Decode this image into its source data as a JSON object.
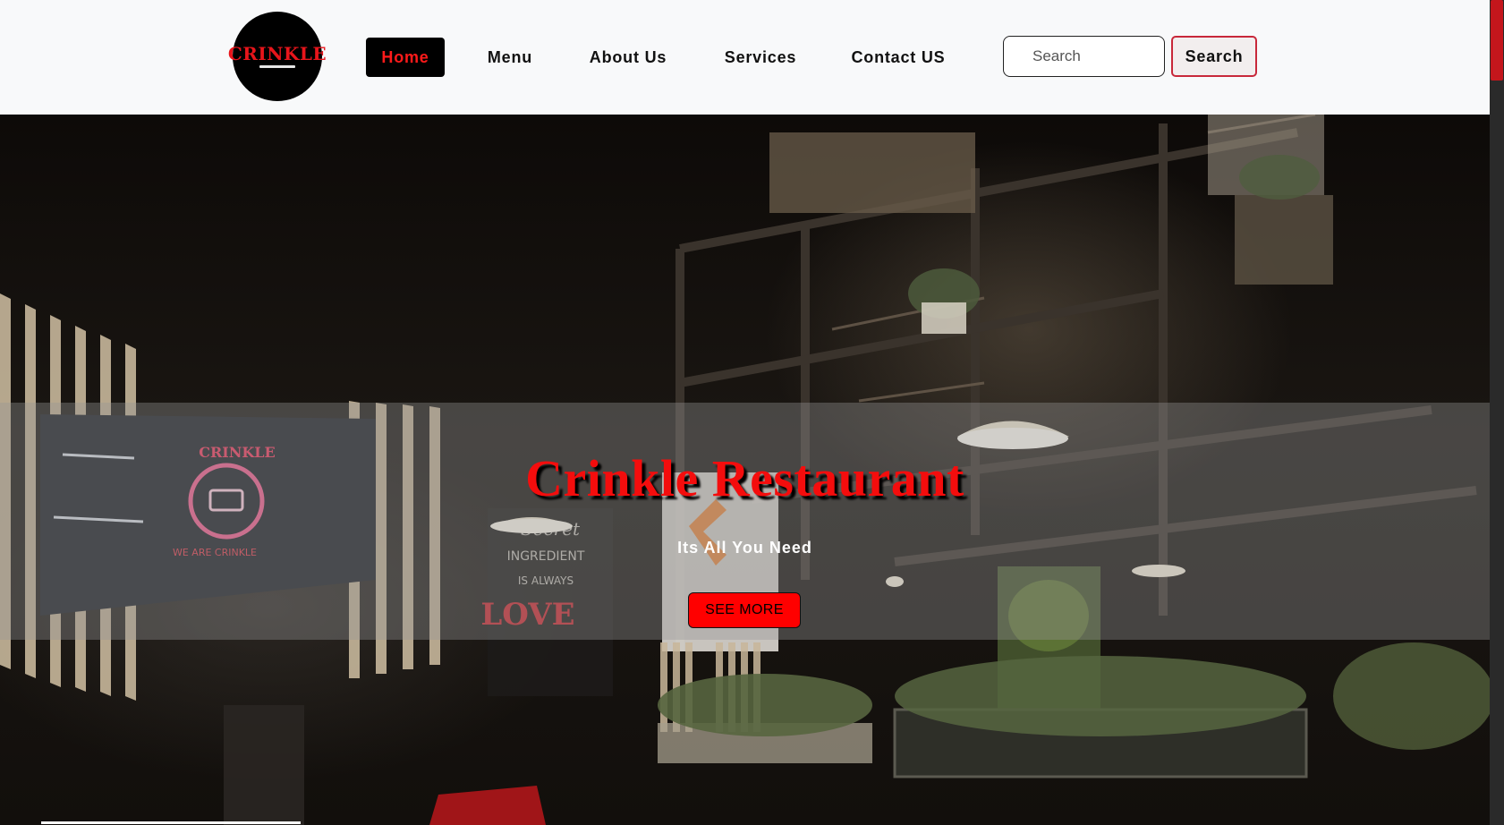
{
  "header": {
    "logo_text": "CRINKLE",
    "nav": [
      {
        "label": "Home",
        "active": true
      },
      {
        "label": "Menu",
        "active": false
      },
      {
        "label": "About Us",
        "active": false
      },
      {
        "label": "Services",
        "active": false
      },
      {
        "label": "Contact US",
        "active": false
      }
    ],
    "search": {
      "placeholder": "Search",
      "value": "",
      "button_label": "Search"
    }
  },
  "hero": {
    "title": "Crinkle Restaurant",
    "subtitle": "Its All You Need",
    "cta_label": "SEE MORE",
    "wall_sign": {
      "brand": "CRINKLE",
      "tagline": "WE ARE CRINKLE"
    },
    "mural_text": "Secret INGREDIENT IS ALWAYS LOVE"
  },
  "colors": {
    "accent_red": "#ff0000",
    "brand_red": "#e8151b",
    "header_bg": "#f8f9fa",
    "nav_active_bg": "#000000",
    "search_button_border": "#c8283a",
    "overlay": "rgba(150,150,150,0.38)"
  },
  "icons": {
    "logo": "crinkle-logo-icon",
    "neon_sign": "neon-sign-icon"
  }
}
